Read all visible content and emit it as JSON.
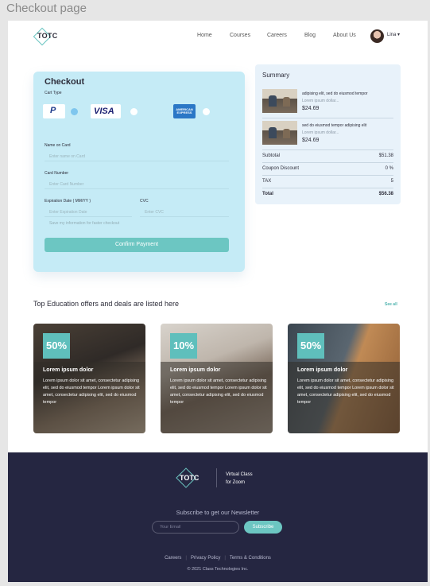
{
  "frame": {
    "title": "Checkout page"
  },
  "header": {
    "logo": "TOTC",
    "nav": [
      "Home",
      "Courses",
      "Careers",
      "Blog",
      "About Us"
    ],
    "user": "Lina"
  },
  "checkout": {
    "title": "Checkout",
    "cart_type_label": "Cart Type",
    "cards": [
      "PayPal",
      "VISA",
      "AMERICAN EXPRESS"
    ],
    "visa_text": "VISA",
    "amex_text": "AMERICAN EXPRESS",
    "name_label": "Name on Card",
    "name_placeholder": "Enter name on Card",
    "number_label": "Card Number",
    "number_placeholder": "Enter Card Number",
    "expiry_label": "Expiration Date ( MM/YY )",
    "expiry_placeholder": "Enter Expiration Date",
    "cvc_label": "CVC",
    "cvc_placeholder": "Enter CVC",
    "remember_label": "Save my information for faster checkout",
    "confirm_label": "Confirm Payment"
  },
  "summary": {
    "title": "Summary",
    "items": [
      {
        "title": "adipising elit, sed do eiusmod tempor",
        "sub": "Lorem ipsum dollar...",
        "price": "$24.69"
      },
      {
        "title": "sed do eiusmod tempor adipising elit",
        "sub": "Lorem ipsum dollar...",
        "price": "$24.69"
      }
    ],
    "rows": [
      {
        "label": "Subtotal",
        "value": "$51.38"
      },
      {
        "label": "Coupon Discount",
        "value": "0 %"
      },
      {
        "label": "TAX",
        "value": "5"
      },
      {
        "label": "Total",
        "value": "$56.38"
      }
    ]
  },
  "offers": {
    "title": "Top Education offers and deals are listed here",
    "see_all": "See all",
    "cards": [
      {
        "discount": "50%",
        "title": "Lorem ipsum dolor",
        "body": "Lorem ipsum dolor sit amet, consectetur adipising elit, sed do eiusmod tempor Lorem ipsum dolor sit amet, consectetur adipising elit, sed do eiusmod tempor"
      },
      {
        "discount": "10%",
        "title": "Lorem ipsum dolor",
        "body": "Lorem ipsum dolor sit amet, consectetur adipising elit, sed do eiusmod tempor Lorem ipsum dolor sit amet, consectetur adipising elit, sed do eiusmod tempor"
      },
      {
        "discount": "50%",
        "title": "Lorem ipsum dolor",
        "body": "Lorem ipsum dolor sit amet, consectetur adipising elit, sed do eiusmod tempor Lorem ipsum dolor sit amet, consectetur adipising elit, sed do eiusmod tempor"
      }
    ]
  },
  "footer": {
    "logo": "TOTC",
    "tagline_1": "Virtual Class",
    "tagline_2": "for Zoom",
    "newsletter_title": "Subscribe to get our Newsletter",
    "email_placeholder": "Your Email",
    "subscribe_label": "Subscribe",
    "links": [
      "Careers",
      "Privacy Policy",
      "Terms & Conditions"
    ],
    "copyright": "© 2021 Class Technologies Inc."
  },
  "colors": {
    "accent": "#6cc6c2",
    "checkout_bg": "#c5ebf6",
    "footer_bg": "#252641"
  }
}
